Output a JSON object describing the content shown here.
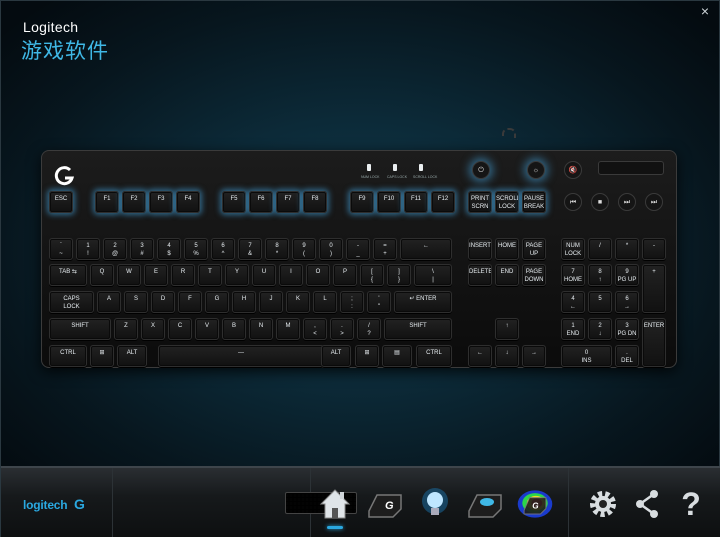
{
  "window": {
    "close_label": "×"
  },
  "header": {
    "brand": "Logitech",
    "subtitle": "游戏软件"
  },
  "keyboard": {
    "leds": [
      {
        "label": "NUM LOCK"
      },
      {
        "label": "CAPS LOCK"
      },
      {
        "label": "SCROLL LOCK"
      }
    ],
    "media_buttons": {
      "game_mode": "⏻",
      "backlight": "☼",
      "mute": "🔇",
      "prev": "⏮",
      "stop": "■",
      "play": "⏭",
      "next": "⏭"
    },
    "fn_row": [
      "ESC",
      "F1",
      "F2",
      "F3",
      "F4",
      "F5",
      "F6",
      "F7",
      "F8",
      "F9",
      "F10",
      "F11",
      "F12"
    ],
    "sys_keys": [
      "PRINT\nSCRN\nSYSRQ",
      "SCROLL\nLOCK",
      "PAUSE\nBREAK"
    ],
    "row1": [
      "`\n~",
      "1\n!",
      "2\n@",
      "3\n#",
      "4\n$",
      "5\n%",
      "6\n^",
      "7\n&",
      "8\n*",
      "9\n(",
      "0\n)",
      "-\n_",
      "=\n+",
      "←"
    ],
    "row2": [
      "TAB ⇆",
      "Q",
      "W",
      "E",
      "R",
      "T",
      "Y",
      "U",
      "I",
      "O",
      "P",
      "[\n{",
      "]\n}",
      "\\\n|"
    ],
    "row3": [
      "CAPS\nLOCK",
      "A",
      "S",
      "D",
      "F",
      "G",
      "H",
      "J",
      "K",
      "L",
      ";\n:",
      "'\n\"",
      "↵ ENTER"
    ],
    "row4": [
      "SHIFT",
      "Z",
      "X",
      "C",
      "V",
      "B",
      "N",
      "M",
      ",\n<",
      ".\n>",
      "/\n?",
      "SHIFT"
    ],
    "row5": [
      "CTRL",
      "⊞",
      "ALT",
      "—",
      "ALT",
      "⊞",
      "▤",
      "CTRL"
    ],
    "nav_top": [
      "INSERT",
      "HOME",
      "PAGE\nUP"
    ],
    "nav_bottom": [
      "DELETE",
      "END",
      "PAGE\nDOWN"
    ],
    "arrows": [
      "↑",
      "←",
      "↓",
      "→"
    ],
    "numpad": {
      "row1": [
        "NUM\nLOCK",
        "/",
        "*",
        "-"
      ],
      "row2": [
        "7\nHOME",
        "8\n↑",
        "9\nPG UP"
      ],
      "row3": [
        "4\n←",
        "5",
        "6\n→"
      ],
      "row4": [
        "1\nEND",
        "2\n↓",
        "3\nPG DN"
      ],
      "row5": [
        "0\nINS",
        ".\nDEL"
      ],
      "plus": "+",
      "enter": "ENTER"
    }
  },
  "bottom": {
    "logo_text": "logitech",
    "logo_g": "G",
    "nav": [
      {
        "name": "home",
        "label": "Home"
      },
      {
        "name": "customize-keys",
        "label": "G"
      },
      {
        "name": "lighting",
        "label": "Lighting"
      },
      {
        "name": "game-mode",
        "label": "Game mode"
      },
      {
        "name": "heatmap",
        "label": "Heatmap"
      }
    ],
    "right": [
      {
        "name": "settings",
        "glyph": "⚙"
      },
      {
        "name": "share",
        "glyph": "<"
      },
      {
        "name": "help",
        "glyph": "?"
      }
    ]
  },
  "colors": {
    "accent": "#2aa8e0",
    "title_blue": "#3fb8e6",
    "background": "#0c2a38"
  }
}
